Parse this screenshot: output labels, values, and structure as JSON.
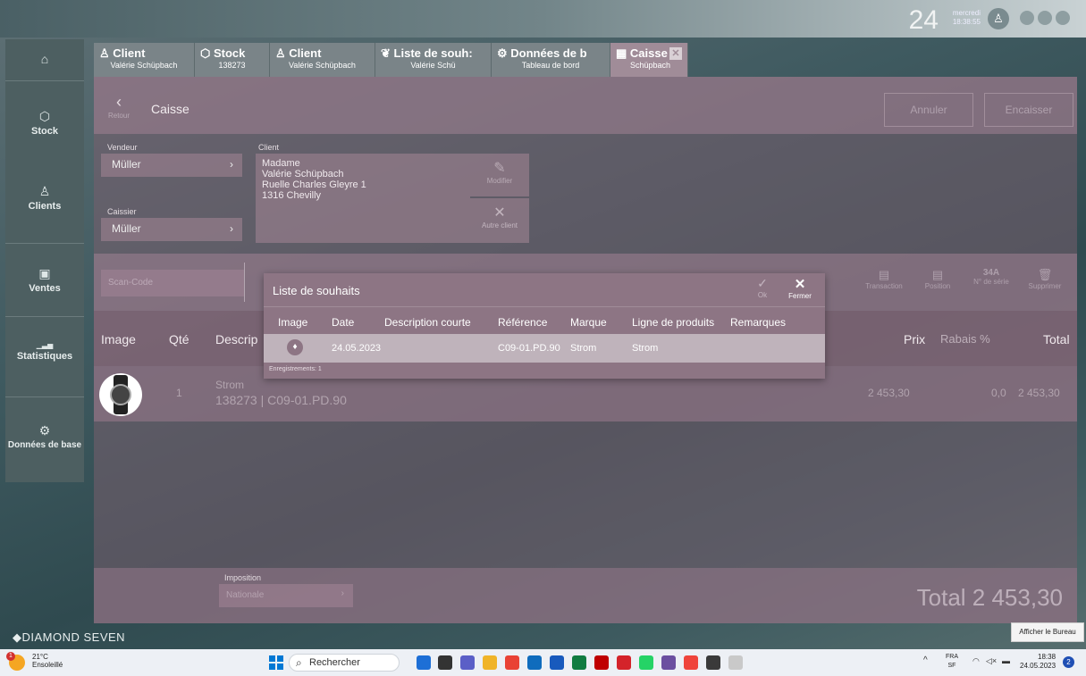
{
  "topbar": {
    "clock_big": "24",
    "clock_weekday": "mercredi",
    "clock_time": "18:38:55",
    "user_icon": "user-icon",
    "window_dots": [
      "dot-1",
      "dot-2",
      "dot-3"
    ]
  },
  "sidebar": {
    "home_icon": "home-icon",
    "items": [
      {
        "label": "Stock",
        "icon": "cube-icon",
        "glyph": "⬡"
      },
      {
        "label": "Clients",
        "icon": "person-icon",
        "glyph": "♙"
      },
      {
        "label": "Ventes",
        "icon": "register-icon",
        "glyph": "▣"
      },
      {
        "label": "Statistiques",
        "icon": "chart-icon",
        "glyph": "▁▃▅"
      },
      {
        "label": "Données de base",
        "icon": "gear-icon",
        "glyph": "⚙"
      }
    ]
  },
  "tabs": [
    {
      "title": "Client",
      "subtitle": "Valérie Schüpbach",
      "icon": "person-icon",
      "glyph": "♙"
    },
    {
      "title": "Stock",
      "subtitle": "138273",
      "icon": "cube-icon",
      "glyph": "⬡"
    },
    {
      "title": "Client",
      "subtitle": "Valérie Schüpbach",
      "icon": "person-icon",
      "glyph": "♙"
    },
    {
      "title": "Liste de souh:",
      "subtitle": "Valérie Schü",
      "icon": "wishlist-icon",
      "glyph": "❦"
    },
    {
      "title": "Données de b",
      "subtitle": "Tableau de bord",
      "icon": "gear-icon",
      "glyph": "⚙"
    },
    {
      "title": "Caisse",
      "subtitle": "Schüpbach",
      "icon": "register-icon",
      "glyph": "▦",
      "close": "✕"
    }
  ],
  "caisse": {
    "back_label": "Retour",
    "title": "Caisse",
    "annuler": "Annuler",
    "encaisser": "Encaisser",
    "vendeur_label": "Vendeur",
    "vendeur_value": "Müller",
    "caissier_label": "Caissier",
    "caissier_value": "Müller",
    "client_label": "Client",
    "client_lines": [
      "Madame",
      "Valérie Schüpbach",
      "Ruelle Charles Gleyre 1",
      "1316 Chevilly"
    ],
    "modifier_label": "Modifier",
    "autre_client_label": "Autre client",
    "scan_placeholder": "Scan-Code",
    "toolbar_right": [
      "Transaction",
      "Position",
      "N° de série",
      "Supprimer"
    ],
    "table_headers": {
      "image": "Image",
      "qte": "Qté",
      "description": "Descrip",
      "prix": "Prix",
      "rabais": "Rabais %",
      "total": "Total"
    },
    "line": {
      "qte": "1",
      "marque": "Strom",
      "details": "138273 | C09-01.PD.90",
      "prix": "2 453,30",
      "rabais": "0,0",
      "total": "2 453,30"
    },
    "imposition_label": "Imposition",
    "imposition_value": "Nationale",
    "grand_total": "Total 2 453,30"
  },
  "modal": {
    "title": "Liste de souhaits",
    "ok_label": "Ok",
    "fermer_label": "Fermer",
    "columns": [
      "Image",
      "Date",
      "Description courte",
      "Référence",
      "Marque",
      "Ligne de produits",
      "Remarques"
    ],
    "row": {
      "date": "24.05.2023",
      "description": "",
      "reference": "C09-01.PD.90",
      "marque": "Strom",
      "ligne": "Strom",
      "remarques": ""
    },
    "footer": "Enregistrements: 1"
  },
  "brand": "DIAMOND SEVEN",
  "tooltip": "Afficher le Bureau",
  "taskbar": {
    "weather_temp": "21°C",
    "weather_desc": "Ensoleillé",
    "search_placeholder": "Rechercher",
    "lang_top": "FRA",
    "lang_bottom": "SF",
    "time": "18:38",
    "date": "24.05.2023",
    "apps": [
      {
        "name": "bing-icon",
        "color": "#1d6fd6"
      },
      {
        "name": "taskview-icon",
        "color": "#333333"
      },
      {
        "name": "teams-icon",
        "color": "#5b5fc7"
      },
      {
        "name": "explorer-icon",
        "color": "#f0b428"
      },
      {
        "name": "chrome-icon",
        "color": "#e94235"
      },
      {
        "name": "outlook-icon",
        "color": "#0f6cbd"
      },
      {
        "name": "word-icon",
        "color": "#185abd"
      },
      {
        "name": "excel-icon",
        "color": "#107c41"
      },
      {
        "name": "filezilla-icon",
        "color": "#bf0000"
      },
      {
        "name": "acrobat-icon",
        "color": "#d4232a"
      },
      {
        "name": "whatsapp-icon",
        "color": "#25d366"
      },
      {
        "name": "diamond-app-icon",
        "color": "#6b4fa0"
      },
      {
        "name": "anydesk-icon",
        "color": "#ef443b"
      },
      {
        "name": "terminal-icon",
        "color": "#3a3a3a"
      },
      {
        "name": "gem-app-icon",
        "color": "#c9c9c9"
      }
    ]
  }
}
